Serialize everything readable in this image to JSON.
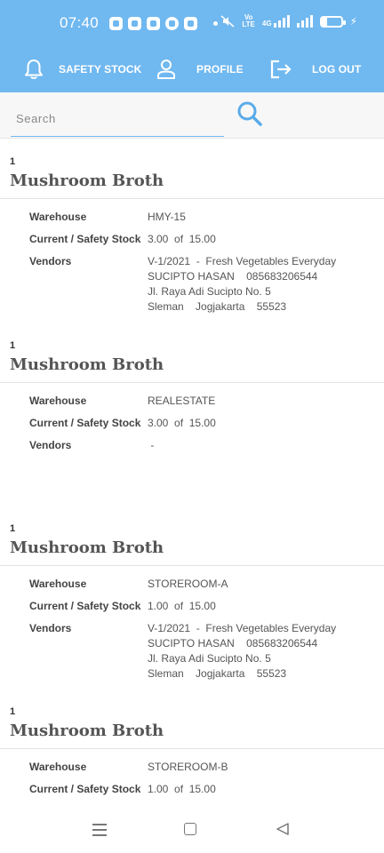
{
  "status_bar": {
    "time": "07:40",
    "network_label_top": "Vo",
    "network_label_bottom": "LTE",
    "network_4g": "4G",
    "icons": [
      "chat-app-icon",
      "maps-icon",
      "email-icon",
      "messenger-icon",
      "home-app-icon",
      "mute-icon",
      "signal-icon",
      "battery-icon",
      "charging-icon"
    ]
  },
  "nav": {
    "safety_stock": "SAFETY STOCK",
    "profile": "PROFILE",
    "logout": "LOG OUT",
    "accent_color": "#70b8f0"
  },
  "search": {
    "placeholder": "Search",
    "value": ""
  },
  "labels": {
    "warehouse": "Warehouse",
    "current_safety": "Current / Safety Stock",
    "vendors": "Vendors",
    "of": "of"
  },
  "items": [
    {
      "qty": "1",
      "name": "Mushroom Broth",
      "warehouse": "HMY-15",
      "current": "3.00",
      "safety": "15.00",
      "vendor_lines": [
        "V-1/2021  -  Fresh Vegetables Everyday",
        "SUCIPTO HASAN    085683206544",
        "Jl. Raya Adi Sucipto No. 5",
        "Sleman    Jogjakarta    55523"
      ]
    },
    {
      "qty": "1",
      "name": "Mushroom Broth",
      "warehouse": "REALESTATE",
      "current": "3.00",
      "safety": "15.00",
      "vendor_lines": [
        " -"
      ]
    },
    {
      "qty": "1",
      "name": "Mushroom Broth",
      "warehouse": "STOREROOM-A",
      "current": "1.00",
      "safety": "15.00",
      "vendor_lines": [
        "V-1/2021  -  Fresh Vegetables Everyday",
        "SUCIPTO HASAN    085683206544",
        "Jl. Raya Adi Sucipto No. 5",
        "Sleman    Jogjakarta    55523"
      ]
    },
    {
      "qty": "1",
      "name": "Mushroom Broth",
      "warehouse": "STOREROOM-B",
      "current": "1.00",
      "safety": "15.00",
      "vendor_lines": []
    }
  ],
  "system_nav": {
    "icons": [
      "menu-icon",
      "home-icon",
      "back-icon"
    ]
  }
}
